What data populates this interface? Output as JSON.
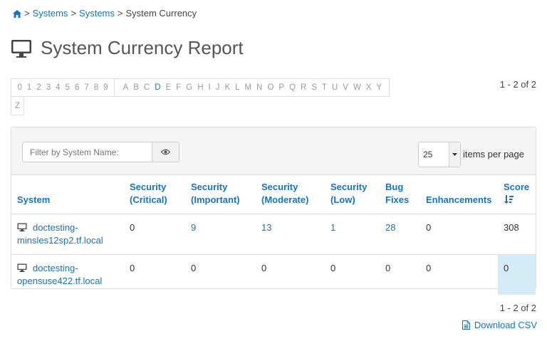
{
  "breadcrumb": {
    "items": [
      "Systems",
      "Systems"
    ],
    "current": "System Currency",
    "separator": ">"
  },
  "page_title": "System Currency Report",
  "alphabar": {
    "digits": [
      "0",
      "1",
      "2",
      "3",
      "4",
      "5",
      "6",
      "7",
      "8",
      "9"
    ],
    "letters": [
      "A",
      "B",
      "C",
      "D",
      "E",
      "F",
      "G",
      "H",
      "I",
      "J",
      "K",
      "L",
      "M",
      "N",
      "O",
      "P",
      "Q",
      "R",
      "S",
      "T",
      "U",
      "V",
      "W",
      "X",
      "Y"
    ],
    "last": "Z",
    "active": [
      "D"
    ]
  },
  "pagination": {
    "top": "1 - 2 of 2",
    "bottom": "1 - 2 of 2"
  },
  "filter": {
    "placeholder": "Filter by System Name:"
  },
  "per_page": {
    "value": "25",
    "label": "items per page"
  },
  "table": {
    "headers": {
      "system": "System",
      "sec_critical_1": "Security",
      "sec_critical_2": "(Critical)",
      "sec_important_1": "Security",
      "sec_important_2": "(Important)",
      "sec_moderate_1": "Security",
      "sec_moderate_2": "(Moderate)",
      "sec_low_1": "Security",
      "sec_low_2": "(Low)",
      "bug_1": "Bug",
      "bug_2": "Fixes",
      "enhancements": "Enhancements",
      "score": "Score"
    },
    "rows": [
      {
        "system_1": "doctesting-",
        "system_2": "minsles12sp2.tf.local",
        "critical": "0",
        "important": "9",
        "moderate": "13",
        "low": "1",
        "bug": "28",
        "enhancements": "0",
        "score": "308"
      },
      {
        "system_1": "doctesting-",
        "system_2": "opensuse422.tf.local",
        "critical": "0",
        "important": "0",
        "moderate": "0",
        "low": "0",
        "bug": "0",
        "enhancements": "0",
        "score": "0"
      }
    ]
  },
  "download": {
    "label": "Download CSV"
  },
  "colors": {
    "link": "#1a73b8",
    "highlight": "#d4ecf7",
    "panel_bg": "#f5f5f5"
  }
}
